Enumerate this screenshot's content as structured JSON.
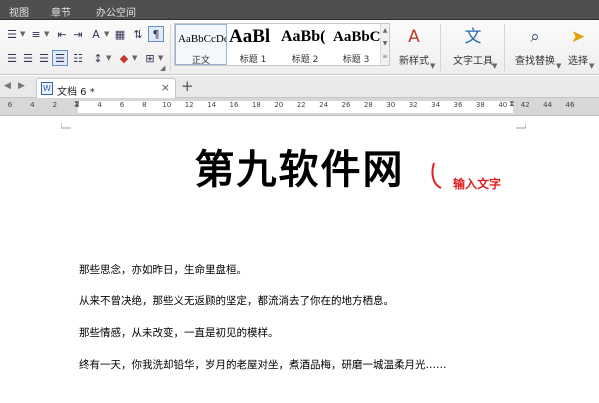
{
  "menubar": {
    "items": [
      "视图",
      "章节",
      "办公空间"
    ]
  },
  "ribbon": {
    "styles": [
      {
        "sample": "AaBbCcDd",
        "name": "正文"
      },
      {
        "sample": "AaBl",
        "name": "标题 1"
      },
      {
        "sample": "AaBb(",
        "name": "标题 2"
      },
      {
        "sample": "AaBbC",
        "name": "标题 3"
      }
    ],
    "new_style": "新样式",
    "text_tools": "文字工具",
    "find_replace": "查找替换",
    "select": "选择"
  },
  "tabs": {
    "document": "文档 6 *"
  },
  "ruler": {
    "marks": [
      "6",
      "4",
      "2",
      "2",
      "4",
      "6",
      "8",
      "10",
      "12",
      "14",
      "16",
      "18",
      "20",
      "22",
      "24",
      "26",
      "28",
      "30",
      "32",
      "34",
      "36",
      "38",
      "40",
      "42",
      "44",
      "46"
    ]
  },
  "document": {
    "title": "第九软件网",
    "paragraphs": [
      "那些思念，亦如昨日，生命里盘桓。",
      "从来不曾决绝，那些义无返顾的坚定，都流淌去了你在的地方栖息。",
      "那些情感，从未改变，一直是初见的模样。",
      "终有一天，你我洗却铅华，岁月的老屋对坐，煮酒品梅，研磨一城温柔月光……"
    ]
  },
  "annotation": {
    "text": "输入文字",
    "color": "#e02020"
  }
}
